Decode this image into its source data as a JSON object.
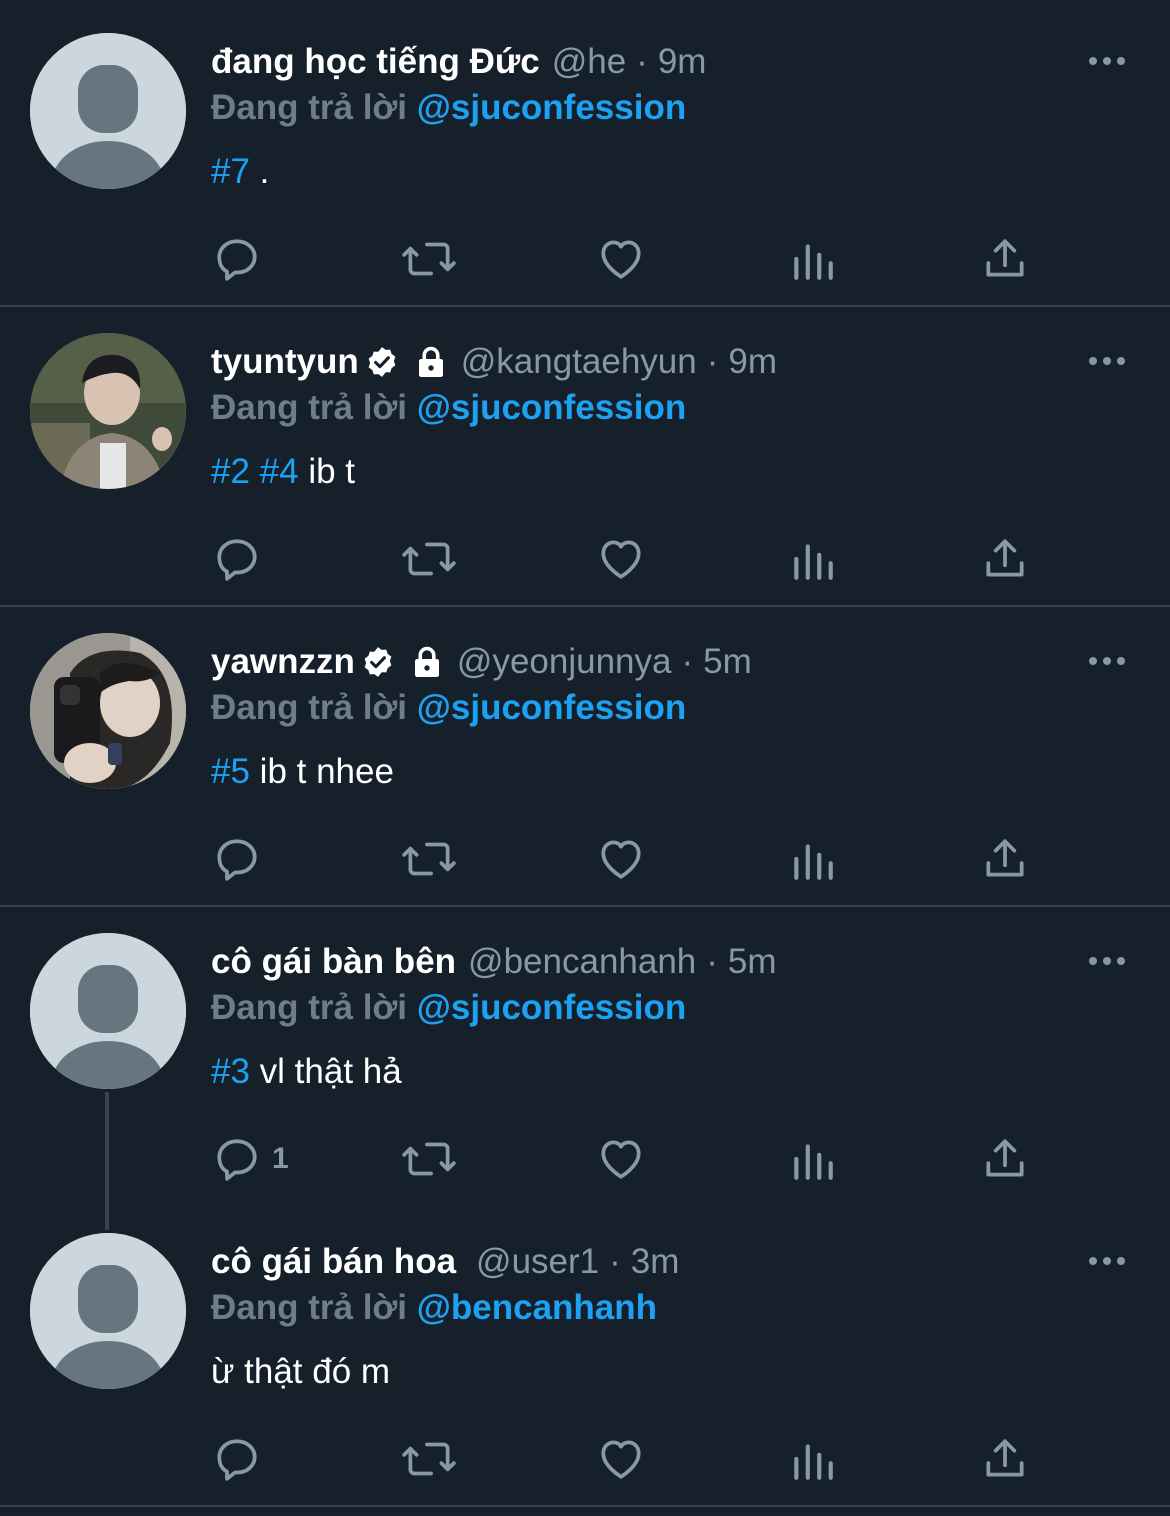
{
  "colors": {
    "background": "#15202b",
    "divider": "#38444d",
    "accent": "#1da1f2",
    "muted": "#8899a6"
  },
  "tweets": [
    {
      "name": "đang học tiếng Đức",
      "handle": "@he",
      "time": "9m",
      "verified": false,
      "locked": false,
      "reply_prefix": "Đang trả lời",
      "reply_to": "@sjuconfession",
      "hashtags": [
        "#7"
      ],
      "text": " .",
      "reply_count": "",
      "avatar": "default-avatar"
    },
    {
      "name": "tyuntyun",
      "handle": "@kangtaehyun",
      "time": "9m",
      "verified": true,
      "locked": true,
      "reply_prefix": "Đang trả lời",
      "reply_to": "@sjuconfession",
      "hashtags": [
        "#2",
        "#4"
      ],
      "text": " ib t",
      "reply_count": "",
      "avatar": "photo-avatar"
    },
    {
      "name": "yawnzzn",
      "handle": "@yeonjunnya",
      "time": "5m",
      "verified": true,
      "locked": true,
      "reply_prefix": "Đang trả lời",
      "reply_to": "@sjuconfession",
      "hashtags": [
        "#5"
      ],
      "text": " ib t nhee",
      "reply_count": "",
      "avatar": "photo-avatar"
    },
    {
      "name": "cô gái bàn bên",
      "handle": "@bencanhanh",
      "time": "5m",
      "verified": false,
      "locked": false,
      "reply_prefix": "Đang trả lời",
      "reply_to": "@sjuconfession",
      "hashtags": [
        "#3"
      ],
      "text": " vl thật hả",
      "reply_count": "1",
      "avatar": "default-avatar"
    },
    {
      "name": "cô gái bán hoa",
      "handle": "@user1",
      "time": "3m",
      "verified": false,
      "locked": false,
      "reply_prefix": "Đang trả lời",
      "reply_to": "@bencanhanh",
      "hashtags": [],
      "text": "ừ thật đó m",
      "reply_count": "",
      "avatar": "default-avatar"
    }
  ],
  "icons": [
    "reply-icon",
    "retweet-icon",
    "like-icon",
    "analytics-icon",
    "share-icon",
    "more-icon",
    "verified-icon",
    "lock-icon"
  ]
}
